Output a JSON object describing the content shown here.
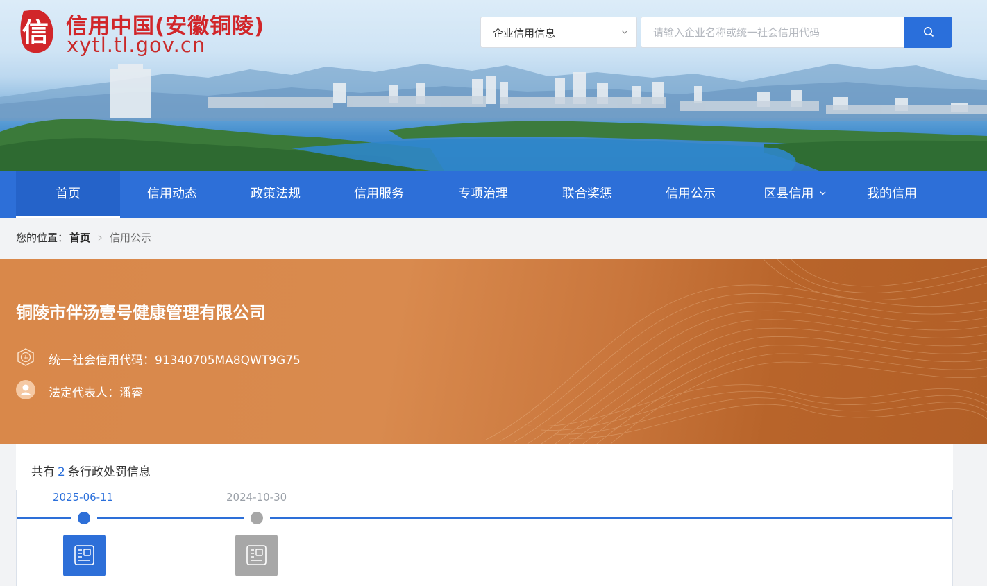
{
  "header": {
    "logo_char": "信",
    "site_title": "信用中国(安徽铜陵)",
    "site_url": "xytl.tl.gov.cn"
  },
  "search": {
    "category_selected": "企业信用信息",
    "placeholder": "请输入企业名称或统一社会信用代码",
    "button_icon": "search-icon"
  },
  "nav": {
    "items": [
      {
        "label": "首页",
        "active": true
      },
      {
        "label": "信用动态"
      },
      {
        "label": "政策法规"
      },
      {
        "label": "信用服务"
      },
      {
        "label": "专项治理"
      },
      {
        "label": "联合奖惩"
      },
      {
        "label": "信用公示"
      },
      {
        "label": "区县信用",
        "has_dropdown": true
      },
      {
        "label": "我的信用"
      }
    ]
  },
  "breadcrumb": {
    "prefix": "您的位置：",
    "home": "首页",
    "current": "信用公示"
  },
  "company": {
    "name": "铜陵市伴汤壹号健康管理有限公司",
    "credit_code_text": "统一社会信用代码：91340705MA8QWT9G75",
    "legal_rep_text": "法定代表人：潘睿"
  },
  "penalties": {
    "count_prefix": "共有",
    "count": "2",
    "count_suffix": "条行政处罚信息",
    "timeline": [
      {
        "date": "2025-06-11",
        "active": true
      },
      {
        "date": "2024-10-30",
        "active": false
      }
    ]
  },
  "colors": {
    "primary": "#2d6fd8",
    "brand_red": "#d1262a",
    "panel_orange": "#d98a4e",
    "inactive_grey": "#a7a7a7"
  }
}
